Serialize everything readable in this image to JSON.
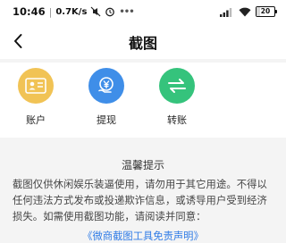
{
  "status_bar": {
    "time": "10:46",
    "network_speed": "0.7K/s",
    "battery_level": "20",
    "icons": [
      "mute-icon",
      "alarm-icon",
      "more-dots-icon",
      "signal-icon",
      "wifi-icon",
      "battery-icon"
    ]
  },
  "nav": {
    "title": "截图",
    "back_icon": "chevron-left-icon"
  },
  "actions": [
    {
      "label": "账户",
      "icon": "id-card-icon",
      "color": "#f1c355"
    },
    {
      "label": "提现",
      "icon": "yuan-wallet-icon",
      "color": "#3f8ee8"
    },
    {
      "label": "转账",
      "icon": "transfer-arrows-icon",
      "color": "#35c37c"
    }
  ],
  "tips": {
    "title": "温馨提示",
    "line1": "截图仅供休闲娱乐装逼使用，请勿用于其它用途。不得以",
    "line2": "任何违法方式发布或投递欺诈信息，或诱导用户受到经济",
    "line3": "损失。如需使用截图功能，请阅读并同意：",
    "link": "《微商截图工具免责声明》",
    "link_color": "#2f7be6"
  }
}
